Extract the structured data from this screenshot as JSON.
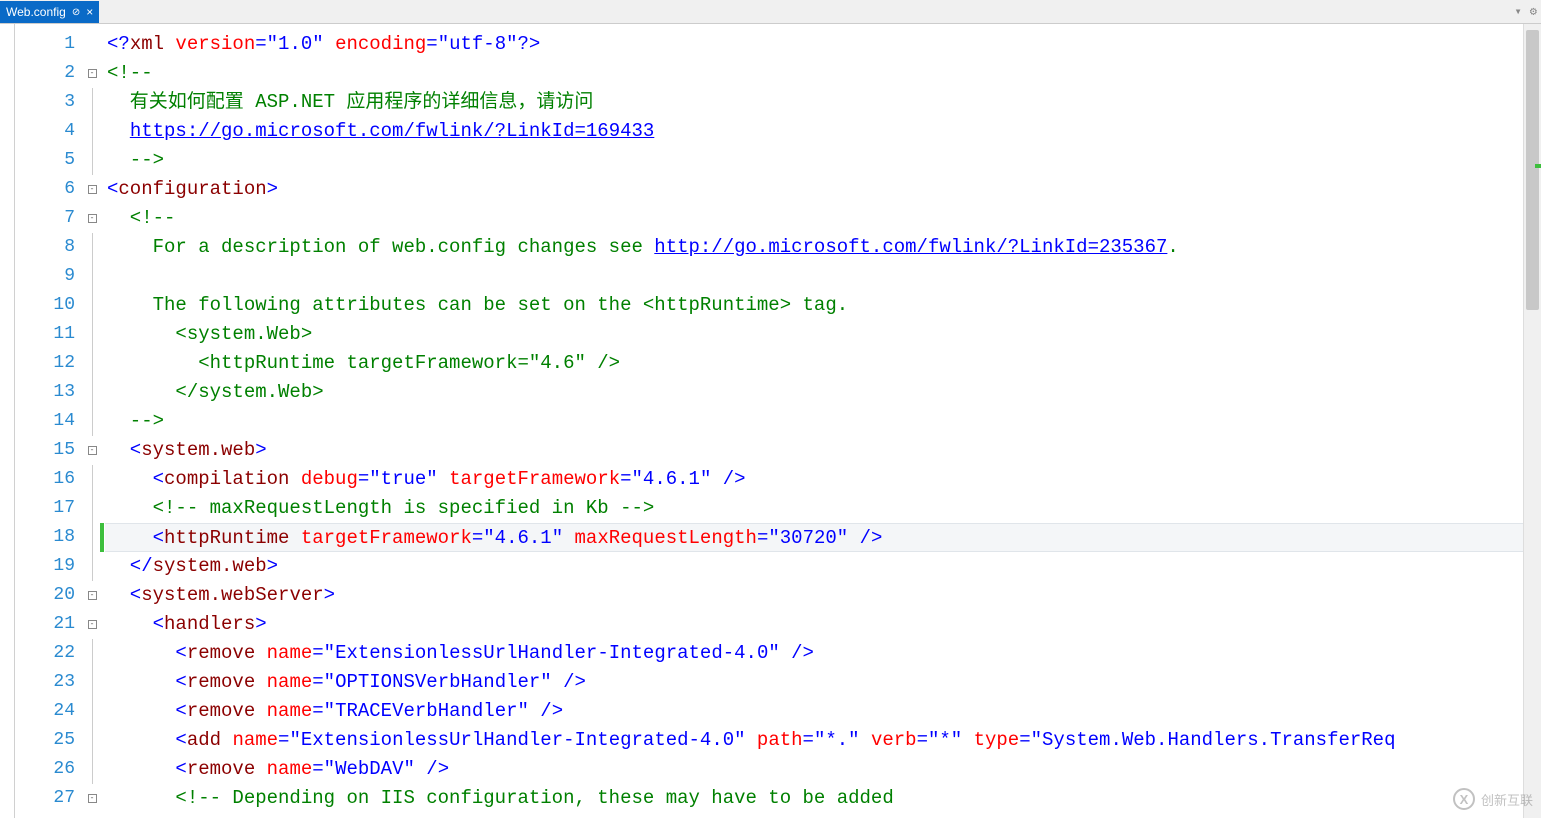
{
  "tab": {
    "title": "Web.config",
    "pin": "⊘",
    "close": "×"
  },
  "toolbar": {
    "dropdown": "▾",
    "gear": "⚙",
    "split": "⬍"
  },
  "lines": [
    "1",
    "2",
    "3",
    "4",
    "5",
    "6",
    "7",
    "8",
    "9",
    "10",
    "11",
    "12",
    "13",
    "14",
    "15",
    "16",
    "17",
    "18",
    "19",
    "20",
    "21",
    "22",
    "23",
    "24",
    "25",
    "26",
    "27"
  ],
  "fold": {
    "2": "-",
    "6": "-",
    "7": "-",
    "15": "-",
    "20": "-",
    "21": "-",
    "27": "-"
  },
  "code": {
    "l1": {
      "a": "<?",
      "b": "xml ",
      "c": "version",
      "d": "=",
      "e": "\"1.0\"",
      "f": " encoding",
      "g": "=",
      "h": "\"utf-8\"",
      "i": "?>"
    },
    "l2": "<!--",
    "l3": "  有关如何配置 ASP.NET 应用程序的详细信息，请访问",
    "l4_pre": "  ",
    "l4_link": "https://go.microsoft.com/fwlink/?LinkId=169433",
    "l5": "  -->",
    "l6": {
      "a": "<",
      "b": "configuration",
      "c": ">"
    },
    "l7": "  <!--",
    "l8_a": "    For a description of web.config changes see ",
    "l8_link": "http://go.microsoft.com/fwlink/?LinkId=235367",
    "l8_b": ".",
    "l9": "",
    "l10": "    The following attributes can be set on the <httpRuntime> tag.",
    "l11": "      <system.Web>",
    "l12": "        <httpRuntime targetFramework=\"4.6\" />",
    "l13": "      </system.Web>",
    "l14": "  -->",
    "l15": {
      "a": "  <",
      "b": "system.web",
      "c": ">"
    },
    "l16": {
      "a": "    <",
      "b": "compilation ",
      "c": "debug",
      "d": "=",
      "e": "\"true\"",
      "f": " targetFramework",
      "g": "=",
      "h": "\"4.6.1\"",
      "i": " />"
    },
    "l17": "    <!-- maxRequestLength is specified in Kb -->",
    "l18": {
      "a": "    <",
      "b": "httpRuntime ",
      "c": "targetFramework",
      "d": "=",
      "e": "\"4.6.1\"",
      "f": " maxRequestLength",
      "g": "=",
      "h": "\"30720\"",
      "i": " />"
    },
    "l19": {
      "a": "  </",
      "b": "system.web",
      "c": ">"
    },
    "l20": {
      "a": "  <",
      "b": "system.webServer",
      "c": ">"
    },
    "l21": {
      "a": "    <",
      "b": "handlers",
      "c": ">"
    },
    "l22": {
      "a": "      <",
      "b": "remove ",
      "c": "name",
      "d": "=",
      "e": "\"ExtensionlessUrlHandler-Integrated-4.0\"",
      "f": " />"
    },
    "l23": {
      "a": "      <",
      "b": "remove ",
      "c": "name",
      "d": "=",
      "e": "\"OPTIONSVerbHandler\"",
      "f": " />"
    },
    "l24": {
      "a": "      <",
      "b": "remove ",
      "c": "name",
      "d": "=",
      "e": "\"TRACEVerbHandler\"",
      "f": " />"
    },
    "l25": {
      "a": "      <",
      "b": "add ",
      "c": "name",
      "d": "=",
      "e": "\"ExtensionlessUrlHandler-Integrated-4.0\"",
      "f": " path",
      "g": "=",
      "h": "\"*.\"",
      "i": " verb",
      "j": "=",
      "k": "\"*\"",
      "l": " type",
      "m": "=",
      "n": "\"System.Web.Handlers.TransferReq"
    },
    "l26": {
      "a": "      <",
      "b": "remove ",
      "c": "name",
      "d": "=",
      "e": "\"WebDAV\"",
      "f": " />"
    },
    "l27": "      <!-- Depending on IIS configuration, these may have to be added"
  },
  "watermark": {
    "text": "创新互联"
  }
}
